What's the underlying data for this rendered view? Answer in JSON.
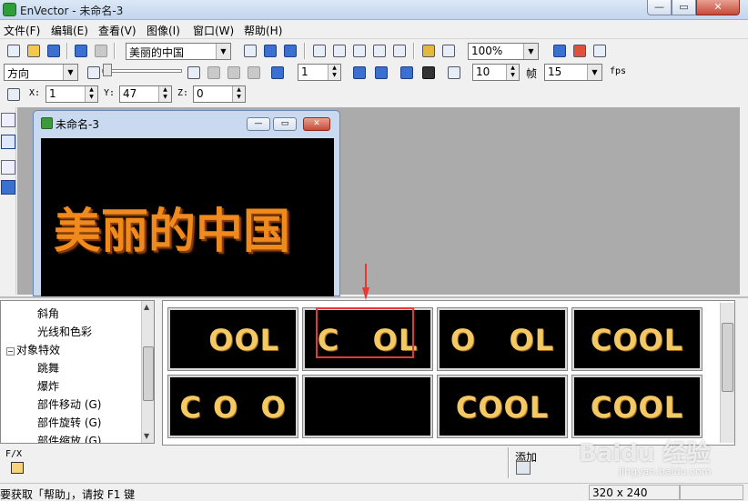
{
  "window": {
    "title": "EnVector - 未命名-3",
    "min": "—",
    "max": "▭",
    "close": "✕"
  },
  "menu": [
    "文件(F)",
    "编辑(E)",
    "查看(V)",
    "图像(I)",
    "窗口(W)",
    "帮助(H)"
  ],
  "toolbar1": {
    "text_combo": "美丽的中国",
    "zoom_combo": "100%"
  },
  "toolbar2": {
    "direction_combo": "方向",
    "frame_value": "1",
    "value_10": "10",
    "frames_label": "帧",
    "fps_value": "15",
    "fps_label": "fps"
  },
  "toolbar3": {
    "x_label": "X:",
    "x_value": "1",
    "y_label": "Y:",
    "y_value": "47",
    "z_label": "Z:",
    "z_value": "0"
  },
  "child_window": {
    "title": "未命名-3",
    "canvas_text": "美丽的中国",
    "min": "—",
    "max": "▭",
    "close": "✕"
  },
  "tree": {
    "items": [
      {
        "label": "斜角",
        "level": 2
      },
      {
        "label": "光线和色彩",
        "level": 2
      },
      {
        "label": "对象特效",
        "level": 1,
        "expander": "−"
      },
      {
        "label": "跳舞",
        "level": 2
      },
      {
        "label": "爆炸",
        "level": 2
      },
      {
        "label": "部件移动 (G)",
        "level": 2
      },
      {
        "label": "部件旋转 (G)",
        "level": 2
      },
      {
        "label": "部件缩放 (G)",
        "level": 2
      }
    ]
  },
  "gallery": {
    "thumbnails": [
      {
        "text": "  OOL"
      },
      {
        "text": "C   OL"
      },
      {
        "text": "O   OL"
      },
      {
        "text": "COOL"
      },
      {
        "text": "C O  O"
      },
      {
        "text": ""
      },
      {
        "text": "COOL"
      },
      {
        "text": "COOL"
      }
    ]
  },
  "bottom": {
    "fx_label": "F/X",
    "add_label": "添加"
  },
  "status": {
    "help_text": "要获取「帮助」，请按 F1 键",
    "dimensions": "320 x 240"
  },
  "watermark": {
    "brand": "Baidu 经验",
    "url": "jingyan.baidu.com"
  }
}
